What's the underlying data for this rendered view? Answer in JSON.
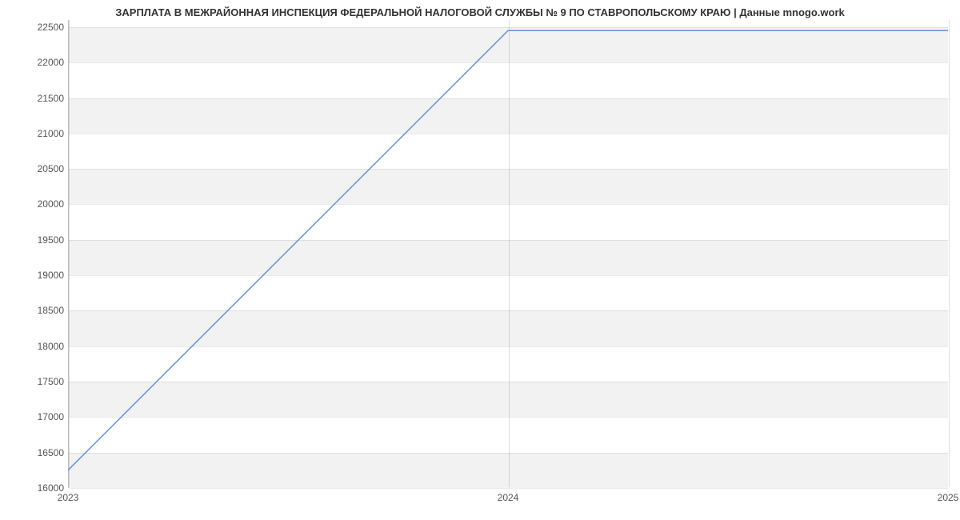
{
  "chart_data": {
    "type": "line",
    "title": "ЗАРПЛАТА В МЕЖРАЙОННАЯ ИНСПЕКЦИЯ ФЕДЕРАЛЬНОЙ НАЛОГОВОЙ СЛУЖБЫ № 9 ПО СТАВРОПОЛЬСКОМУ КРАЮ | Данные mnogo.work",
    "x": [
      2023,
      2024,
      2025
    ],
    "values": [
      16250,
      22450,
      22450
    ],
    "xlabel": "",
    "ylabel": "",
    "xlim": [
      2023,
      2025
    ],
    "ylim": [
      16000,
      22600
    ],
    "y_ticks": [
      16000,
      16500,
      17000,
      17500,
      18000,
      18500,
      19000,
      19500,
      20000,
      20500,
      21000,
      21500,
      22000,
      22500
    ],
    "x_ticks": [
      2023,
      2024,
      2025
    ]
  }
}
